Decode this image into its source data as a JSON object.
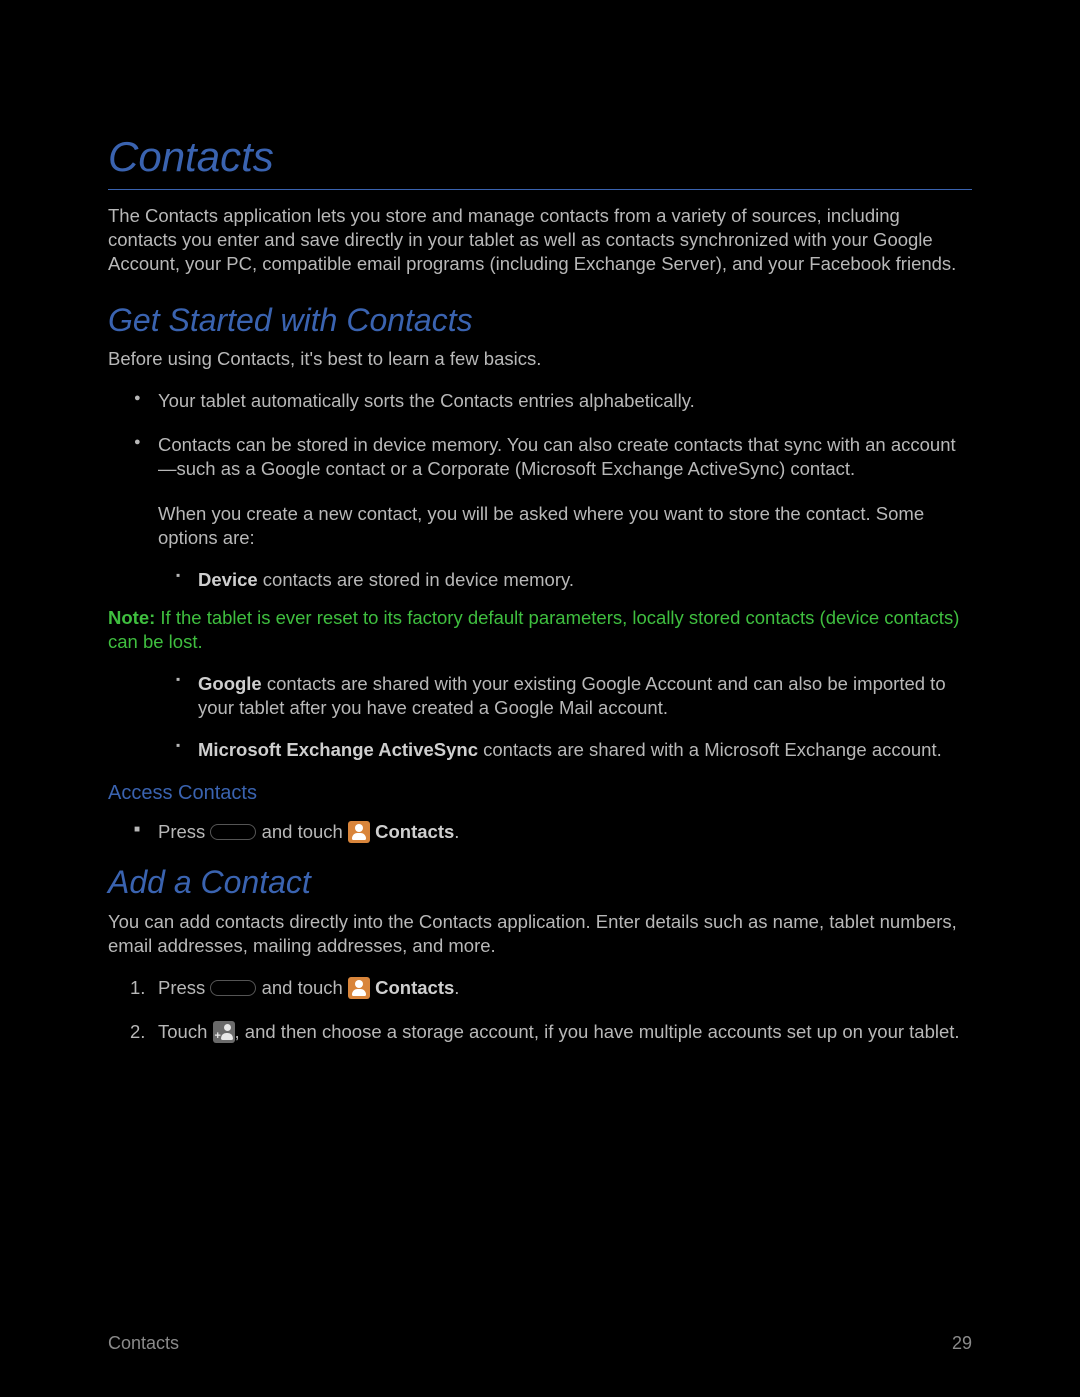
{
  "title": "Contacts",
  "intro": "The Contacts application lets you store and manage contacts from a variety of sources, including contacts you enter and save directly in your tablet as well as contacts synchronized with your Google Account, your PC, compatible email programs (including Exchange Server), and your Facebook friends.",
  "section1": {
    "heading": "Get Started with Contacts",
    "lead": "Before using Contacts, it's best to learn a few basics.",
    "bullet1": "Your tablet automatically sorts the Contacts entries alphabetically.",
    "bullet2": "Contacts can be stored in device memory. You can also create contacts that sync with an account—such as a Google contact or a Corporate (Microsoft Exchange ActiveSync) contact.",
    "subpara": "When you create a new contact, you will be asked where you want to store the contact. Some options are:",
    "device_bold": "Device",
    "device_rest": " contacts are stored in device memory.",
    "note_bold": "Note:",
    "note_rest": " If the tablet is ever reset to its factory default parameters, locally stored contacts (device contacts) can be lost.",
    "google_bold": "Google",
    "google_rest": " contacts are shared with your existing Google Account and can also be imported to your tablet after you have created a Google Mail account.",
    "ms_bold": "Microsoft Exchange ActiveSync",
    "ms_rest": " contacts are shared with a Microsoft Exchange account.",
    "subhead": "Access Contacts",
    "access_press": "Press ",
    "access_touch": " and touch ",
    "access_contacts": " Contacts",
    "access_period": "."
  },
  "section2": {
    "heading": "Add a Contact",
    "lead": "You can add contacts directly into the Contacts application. Enter details such as name, tablet numbers, email addresses, mailing addresses, and more.",
    "step1_press": "Press ",
    "step1_touch": " and touch ",
    "step1_contacts": " Contacts",
    "step1_period": ".",
    "step2_touch": "Touch ",
    "step2_rest": ", and then choose a storage account, if you have multiple accounts set up on your tablet."
  },
  "footer": {
    "left": "Contacts",
    "right": "29"
  }
}
